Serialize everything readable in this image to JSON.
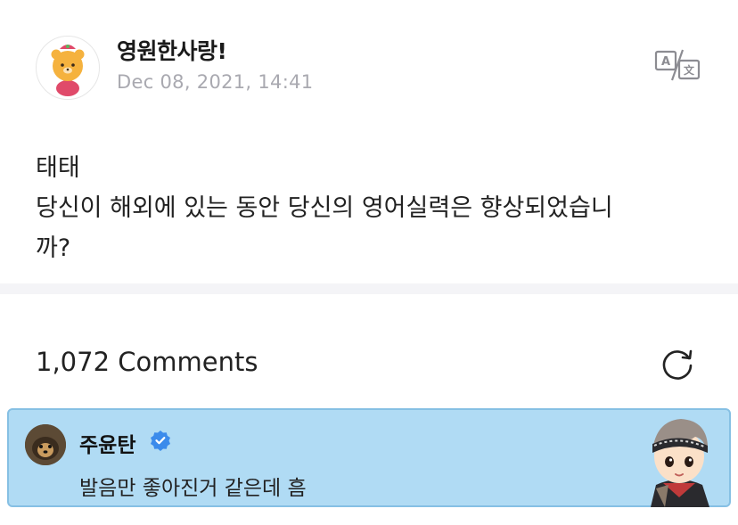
{
  "post": {
    "author": "영원한사랑!",
    "date": "Dec 08, 2021, 14:41",
    "lines": [
      "태태",
      "당신이 해외에 있는 동안 당신의 영어실력은 향상되었습니",
      "까?"
    ],
    "translate_icon": "translate-icon"
  },
  "comments": {
    "count_label": "1,072 Comments",
    "refresh_icon": "refresh-icon",
    "items": [
      {
        "author": "주윤탄",
        "badge_icon": "verified-badge-icon",
        "text": "발음만 좋아진거 같은데 흠",
        "sticker": "character-sticker"
      }
    ]
  },
  "colors": {
    "highlight_bg": "#b0dbf4",
    "highlight_border": "#86c0e4",
    "verified": "#3b8beb",
    "date": "#a9a9b0"
  }
}
